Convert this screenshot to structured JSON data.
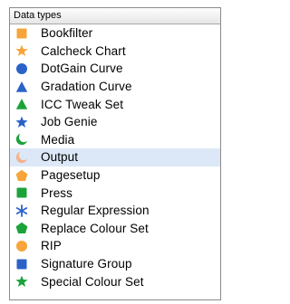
{
  "header": {
    "title": "Data types"
  },
  "colors": {
    "orange": "#f7a43a",
    "blue": "#2b62c9",
    "green": "#1ba33a",
    "selection": "#dce8f7",
    "salmon": "#f5b28c"
  },
  "items": [
    {
      "label": "Bookfilter",
      "icon": "square-icon",
      "color": "orange"
    },
    {
      "label": "Calcheck Chart",
      "icon": "star-icon",
      "color": "orange"
    },
    {
      "label": "DotGain Curve",
      "icon": "circle-icon",
      "color": "blue"
    },
    {
      "label": "Gradation Curve",
      "icon": "triangle-icon",
      "color": "blue"
    },
    {
      "label": "ICC Tweak Set",
      "icon": "triangle-icon",
      "color": "green"
    },
    {
      "label": "Job Genie",
      "icon": "star-icon",
      "color": "blue"
    },
    {
      "label": "Media",
      "icon": "crescent-icon",
      "color": "green"
    },
    {
      "label": "Output",
      "icon": "crescent-icon",
      "color": "salmon",
      "selected": true
    },
    {
      "label": "Pagesetup",
      "icon": "pentagon-icon",
      "color": "orange"
    },
    {
      "label": "Press",
      "icon": "square-icon",
      "color": "green"
    },
    {
      "label": "Regular Expression",
      "icon": "asterisk-icon",
      "color": "blue"
    },
    {
      "label": "Replace Colour Set",
      "icon": "pentagon-icon",
      "color": "green"
    },
    {
      "label": "RIP",
      "icon": "circle-icon",
      "color": "orange"
    },
    {
      "label": "Signature Group",
      "icon": "square-icon",
      "color": "blue"
    },
    {
      "label": "Special Colour Set",
      "icon": "star-icon",
      "color": "green"
    }
  ]
}
